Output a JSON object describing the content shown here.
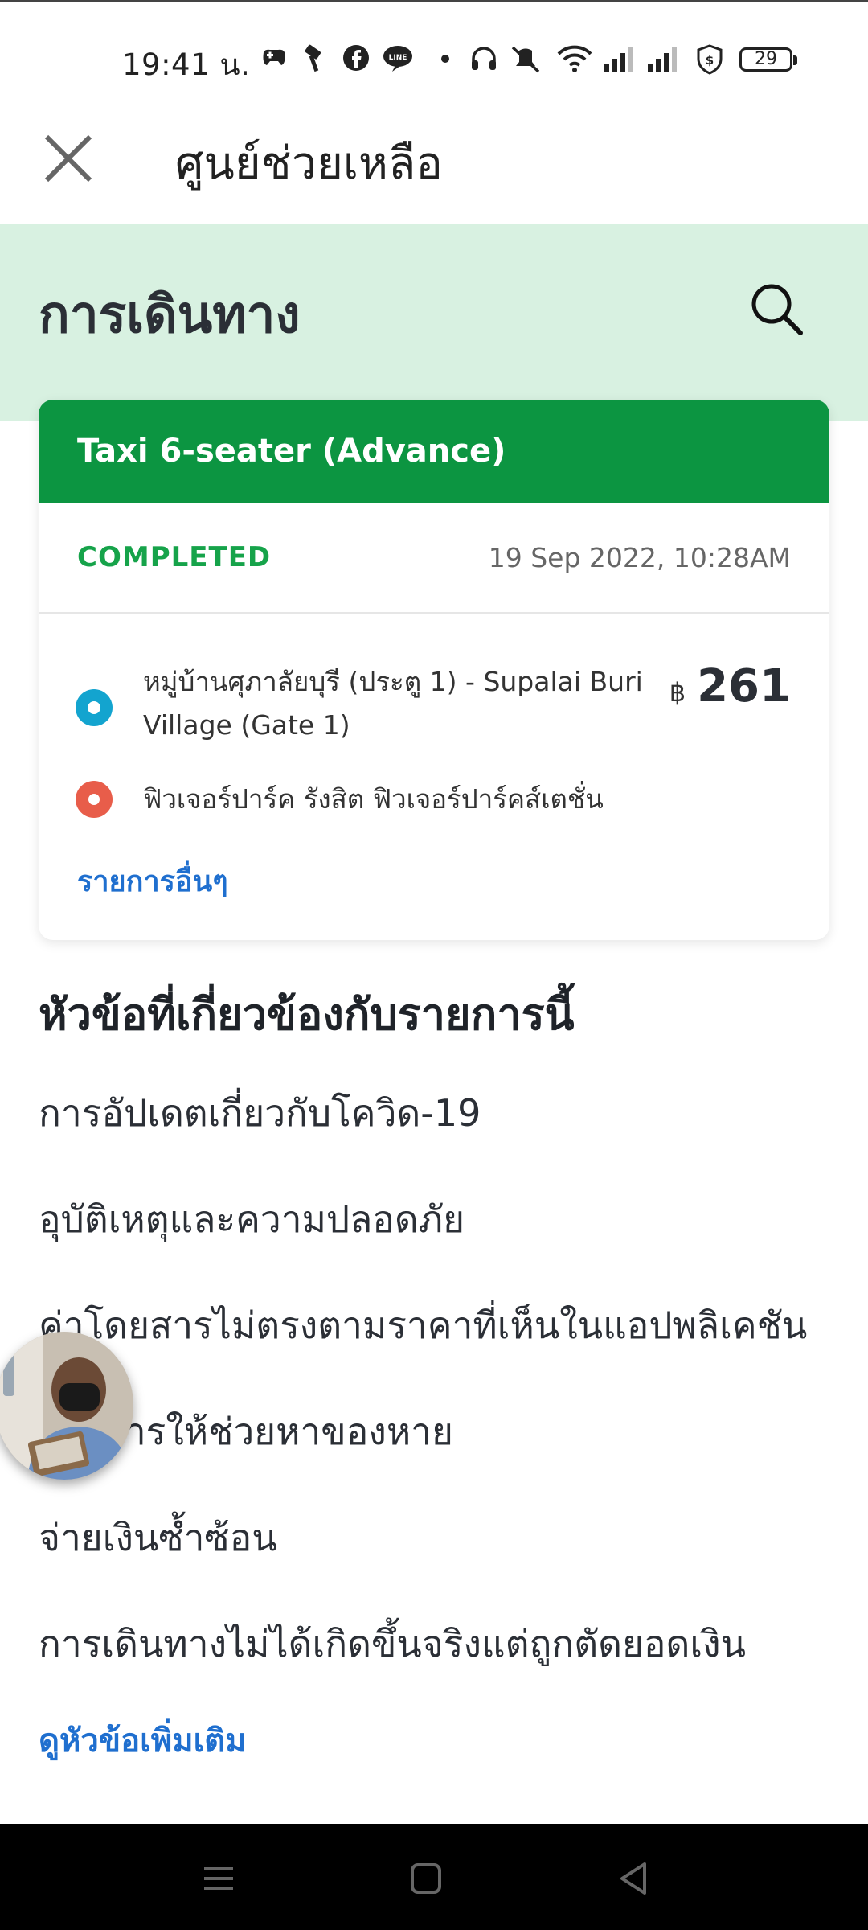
{
  "status_bar": {
    "time": "19:41 น.",
    "battery": "29"
  },
  "app_bar": {
    "title": "ศูนย์ช่วยเหลือ"
  },
  "header": {
    "title": "การเดินทาง"
  },
  "trip_card": {
    "service": "Taxi 6-seater (Advance)",
    "status": "COMPLETED",
    "date": "19 Sep 2022, 10:28AM",
    "pickup": "หมู่บ้านศุภาลัยบุรี (ประตู 1) - Supalai Buri Village (Gate 1)",
    "dropoff": "ฟิวเจอร์ปาร์ค รังสิต ฟิวเจอร์ปาร์คส์เตชั่น",
    "currency": "฿",
    "fare": "261",
    "more_label": "รายการอื่นๆ"
  },
  "topics": {
    "heading": "หัวข้อที่เกี่ยวข้องกับรายการนี้",
    "items": [
      "การอัปเดตเกี่ยวกับโควิด-19",
      "อุบัติเหตุและความปลอดภัย",
      "ค่าโดยสารไม่ตรงตามราคาที่เห็นในแอปพลิเคชัน",
      "ต้องการให้ช่วยหาของหาย",
      "จ่ายเงินซ้ำซ้อน",
      "การเดินทางไม่ได้เกิดขึ้นจริงแต่ถูกตัดยอดเงิน"
    ],
    "more_label": "ดูหัวข้อเพิ่มเติม"
  },
  "colors": {
    "brand_green": "#0c9541",
    "header_band": "#d8f1e1",
    "completed": "#16a34a",
    "link_blue": "#1f6fcf",
    "pickup_dot": "#13a4cf",
    "dropoff_dot": "#e85d4a"
  },
  "icons": {
    "close": "close-icon",
    "search": "search-icon",
    "pickup": "pickup-location-icon",
    "dropoff": "dropoff-location-icon"
  }
}
